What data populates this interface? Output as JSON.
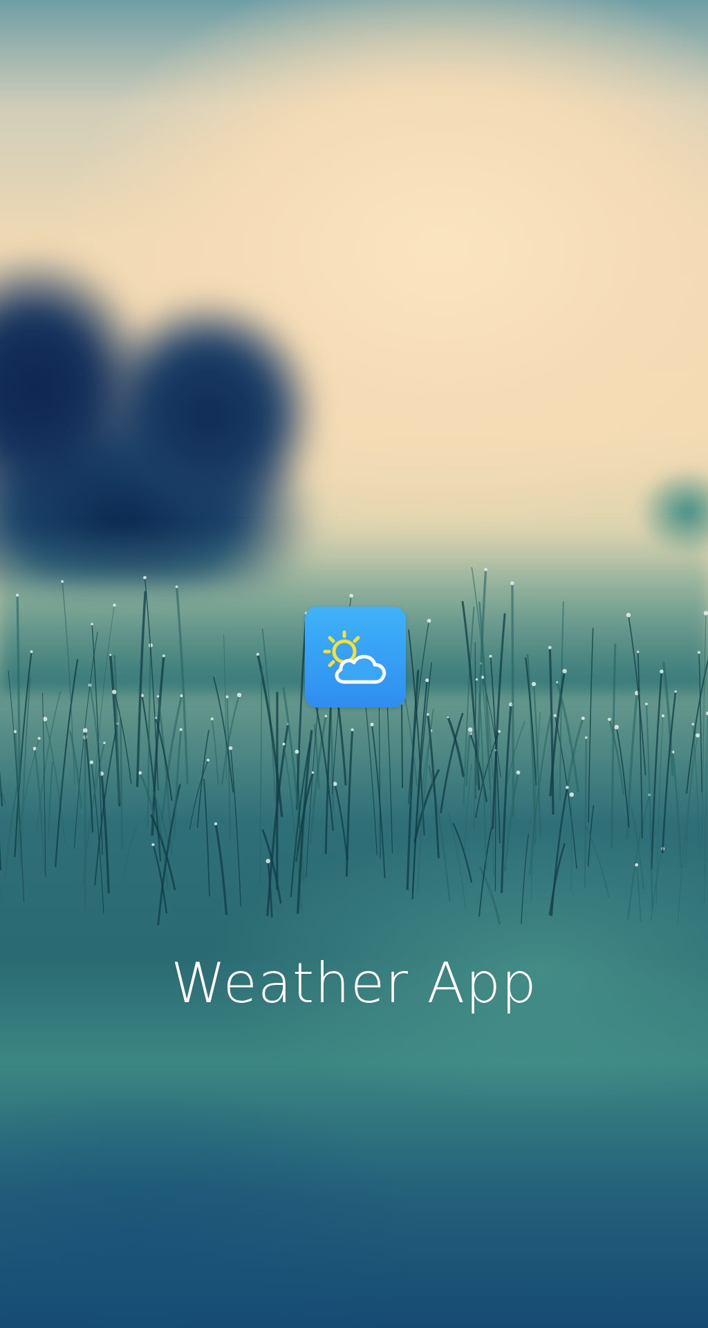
{
  "app": {
    "title": "Weather App"
  },
  "icon": {
    "name": "partly-cloudy-icon",
    "background_colors": [
      "#3fb3f8",
      "#2f8df0"
    ],
    "sun_color": "#f5e13a",
    "cloud_color": "#ffffff"
  },
  "background": {
    "scene": "grass-field-with-dew"
  }
}
